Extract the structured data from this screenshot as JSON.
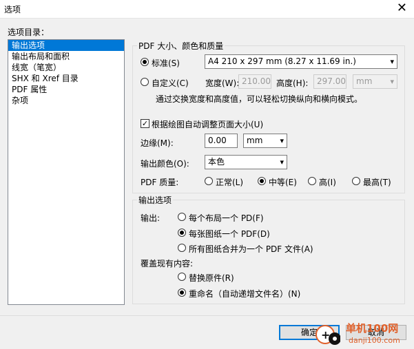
{
  "window": {
    "title": "选项",
    "close_glyph": "✕"
  },
  "left": {
    "heading": "选项目录：",
    "items": [
      "输出选项",
      "输出布局和面积",
      "线宽（笔宽）",
      "SHX 和 Xref 目录",
      "PDF 属性",
      "杂项"
    ],
    "selected_index": 0
  },
  "pdf_group": {
    "legend": "PDF 大小、颜色和质量",
    "standard_label": "标准(S)",
    "standard_value": "A4 210 x 297 mm (8.27 x 11.69 in.)",
    "custom_label": "自定义(C)",
    "width_label": "宽度(W):",
    "width_value": "210.00",
    "height_label": "高度(H):",
    "height_value": "297.00",
    "unit_value": "mm",
    "hint": "通过交换宽度和高度值，可以轻松切换纵向和横向模式。",
    "auto_adjust_label": "根据绘图自动调整页面大小(U)",
    "margin_label": "边缘(M):",
    "margin_value": "0.00",
    "margin_unit": "mm",
    "color_label": "输出颜色(O):",
    "color_value": "本色",
    "quality_label": "PDF 质量:",
    "quality_options": [
      "正常(L)",
      "中等(E)",
      "高(I)",
      "最高(T)"
    ],
    "quality_selected": 1
  },
  "output_group": {
    "legend": "输出选项",
    "output_label": "输出:",
    "output_options": [
      "每个布局一个 PD(F)",
      "每张图纸一个 PDF(D)",
      "所有图纸合并为一个 PDF 文件(A)"
    ],
    "output_selected": 1,
    "overwrite_label": "覆盖现有内容:",
    "overwrite_options": [
      "替换原件(R)",
      "重命名（自动递增文件名）(N)"
    ],
    "overwrite_selected": 1
  },
  "footer": {
    "ok_label": "确定",
    "cancel_label": "取消"
  },
  "watermark": {
    "site": "单机100网",
    "domain": "danji100.com"
  },
  "colors": {
    "selection": "#0078d7",
    "watermark": "#e0602a"
  }
}
